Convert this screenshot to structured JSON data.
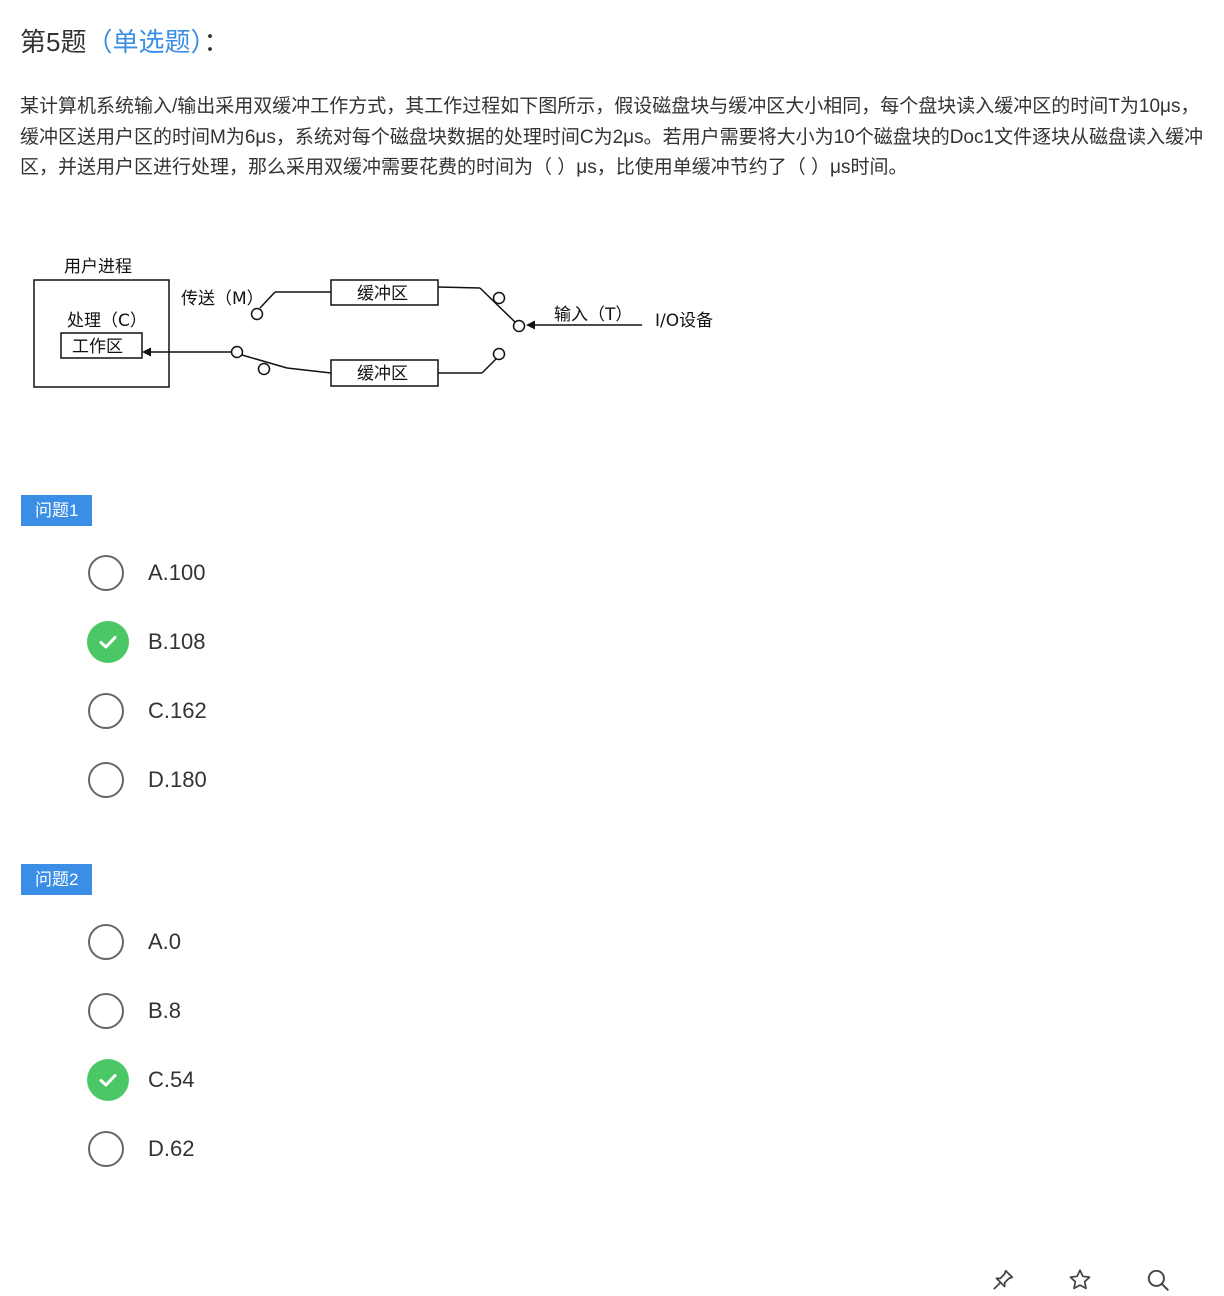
{
  "question": {
    "number_label": "第5题",
    "type_label": "（单选题）",
    "colon": "：",
    "stem": "某计算机系统输入/输出采用双缓冲工作方式，其工作过程如下图所示，假设磁盘块与缓冲区大小相同，每个盘块读入缓冲区的时间T为10μs，缓冲区送用户区的时间M为6μs，系统对每个磁盘块数据的处理时间C为2μs。若用户需要将大小为10个磁盘块的Doc1文件逐块从磁盘读入缓冲区，并送用户区进行处理，那么采用双缓冲需要花费的时间为（ ）μs，比使用单缓冲节约了（ ）μs时间。"
  },
  "diagram": {
    "user_process": "用户进程",
    "process_label": "处理（C）",
    "work_area": "工作区",
    "transfer_label": "传送（M）",
    "buffer_top": "缓冲区",
    "buffer_bottom": "缓冲区",
    "input_label": "输入（T）",
    "io_device": "I/O设备"
  },
  "sub_questions": [
    {
      "badge": "问题1",
      "options": [
        {
          "label": "A.100",
          "selected": false
        },
        {
          "label": "B.108",
          "selected": true
        },
        {
          "label": "C.162",
          "selected": false
        },
        {
          "label": "D.180",
          "selected": false
        }
      ]
    },
    {
      "badge": "问题2",
      "options": [
        {
          "label": "A.0",
          "selected": false
        },
        {
          "label": "B.8",
          "selected": false
        },
        {
          "label": "C.54",
          "selected": true
        },
        {
          "label": "D.62",
          "selected": false
        }
      ]
    }
  ],
  "toolbar": {
    "icons": [
      "pin-icon",
      "star-icon",
      "search-icon"
    ]
  },
  "colors": {
    "accent": "#3a8ee6",
    "correct": "#4cc765",
    "text": "#333333"
  }
}
